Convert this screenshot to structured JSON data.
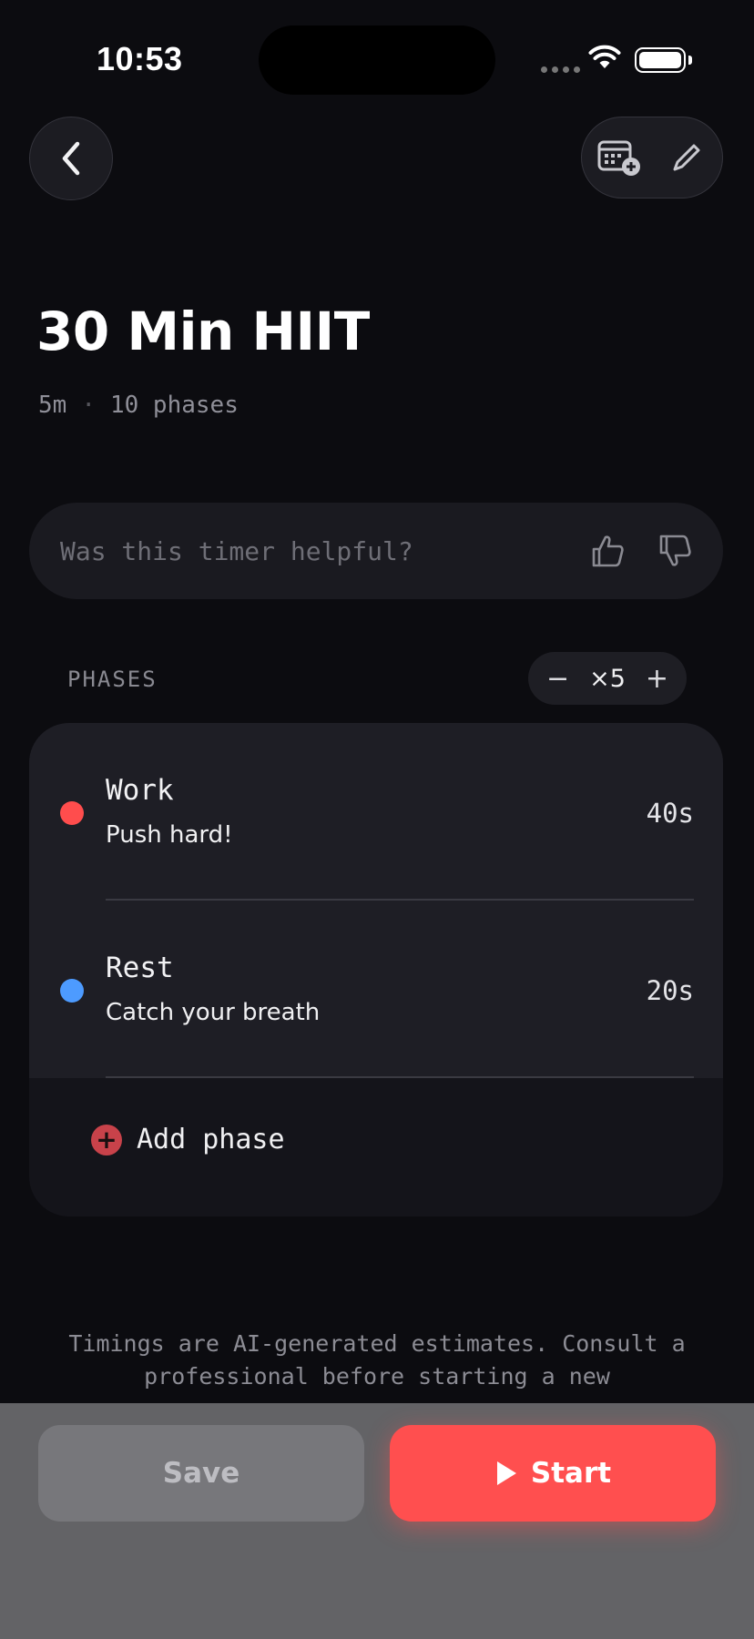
{
  "status_bar": {
    "time": "10:53"
  },
  "header": {
    "back_icon": "chevron-left-icon",
    "schedule_icon": "calendar-add-icon",
    "edit_icon": "pencil-icon"
  },
  "timer": {
    "title": "30 Min HIIT",
    "duration": "5m",
    "separator": "·",
    "phase_count": "10 phases"
  },
  "feedback": {
    "question": "Was this timer helpful?",
    "thumbs_up_icon": "thumbs-up-icon",
    "thumbs_down_icon": "thumbs-down-icon"
  },
  "phases": {
    "label": "PHASES",
    "repeat": {
      "minus": "−",
      "count": "×5",
      "plus": "+"
    },
    "items": [
      {
        "name": "Work",
        "description": "Push hard!",
        "duration": "40s",
        "color": "#ff4d4d"
      },
      {
        "name": "Rest",
        "description": "Catch your breath",
        "duration": "20s",
        "color": "#4d9bff"
      }
    ],
    "add_label": "Add phase",
    "add_icon": "plus-circle-icon"
  },
  "disclaimer": "Timings are AI-generated estimates. Consult a professional before starting a new",
  "actions": {
    "save_label": "Save",
    "start_label": "Start",
    "start_icon": "play-icon"
  },
  "colors": {
    "accent": "#ff4f4f",
    "work": "#ff4d4d",
    "rest": "#4d9bff"
  }
}
